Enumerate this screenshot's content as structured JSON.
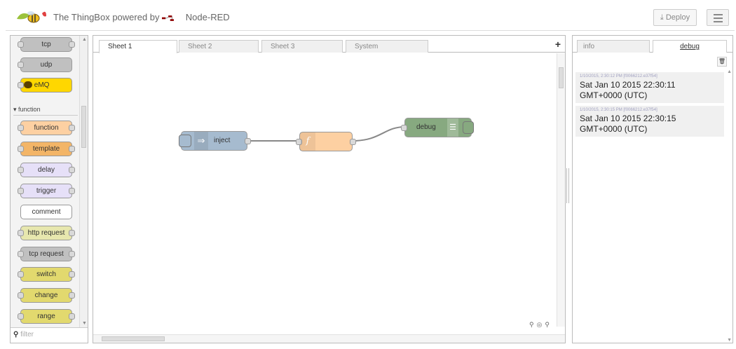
{
  "header": {
    "title": "The ThingBox",
    "powered_by": "powered by",
    "node_red": "Node-RED",
    "deploy_label": "Deploy"
  },
  "palette": {
    "items_top": [
      {
        "label": "tcp",
        "color": "#c0c0c0"
      },
      {
        "label": "udp",
        "color": "#c0c0c0"
      },
      {
        "label": "eMQ",
        "color": "#ffd700"
      }
    ],
    "category": "function",
    "items": [
      {
        "label": "function",
        "color": "#fdd0a2"
      },
      {
        "label": "template",
        "color": "#f3b567"
      },
      {
        "label": "delay",
        "color": "#e6e0f8"
      },
      {
        "label": "trigger",
        "color": "#e6e0f8"
      },
      {
        "label": "comment",
        "color": "#ffffff"
      },
      {
        "label": "http request",
        "color": "#e7e7ae"
      },
      {
        "label": "tcp request",
        "color": "#c0c0c0"
      },
      {
        "label": "switch",
        "color": "#e2d96e"
      },
      {
        "label": "change",
        "color": "#e2d96e"
      },
      {
        "label": "range",
        "color": "#e2d96e"
      }
    ],
    "filter_placeholder": "filter"
  },
  "workspace": {
    "tabs": [
      "Sheet 1",
      "Sheet 2",
      "Sheet 3",
      "System"
    ],
    "active_tab": "Sheet 1",
    "nodes": [
      {
        "label": "inject",
        "color": "#a6bbcf"
      },
      {
        "label": "",
        "color": "#fdd0a2"
      },
      {
        "label": "debug",
        "color": "#87a980"
      }
    ]
  },
  "sidebar": {
    "tabs": [
      "info",
      "debug"
    ],
    "active_tab": "debug",
    "messages": [
      {
        "meta": "1/10/2015, 2:30:12 PM  [f0066212.e37f54]",
        "payload": "Sat Jan 10 2015 22:30:11 GMT+0000 (UTC)"
      },
      {
        "meta": "1/10/2015, 2:30:15 PM  [f0066212.e37f54]",
        "payload": "Sat Jan 10 2015 22:30:15 GMT+0000 (UTC)"
      }
    ]
  }
}
